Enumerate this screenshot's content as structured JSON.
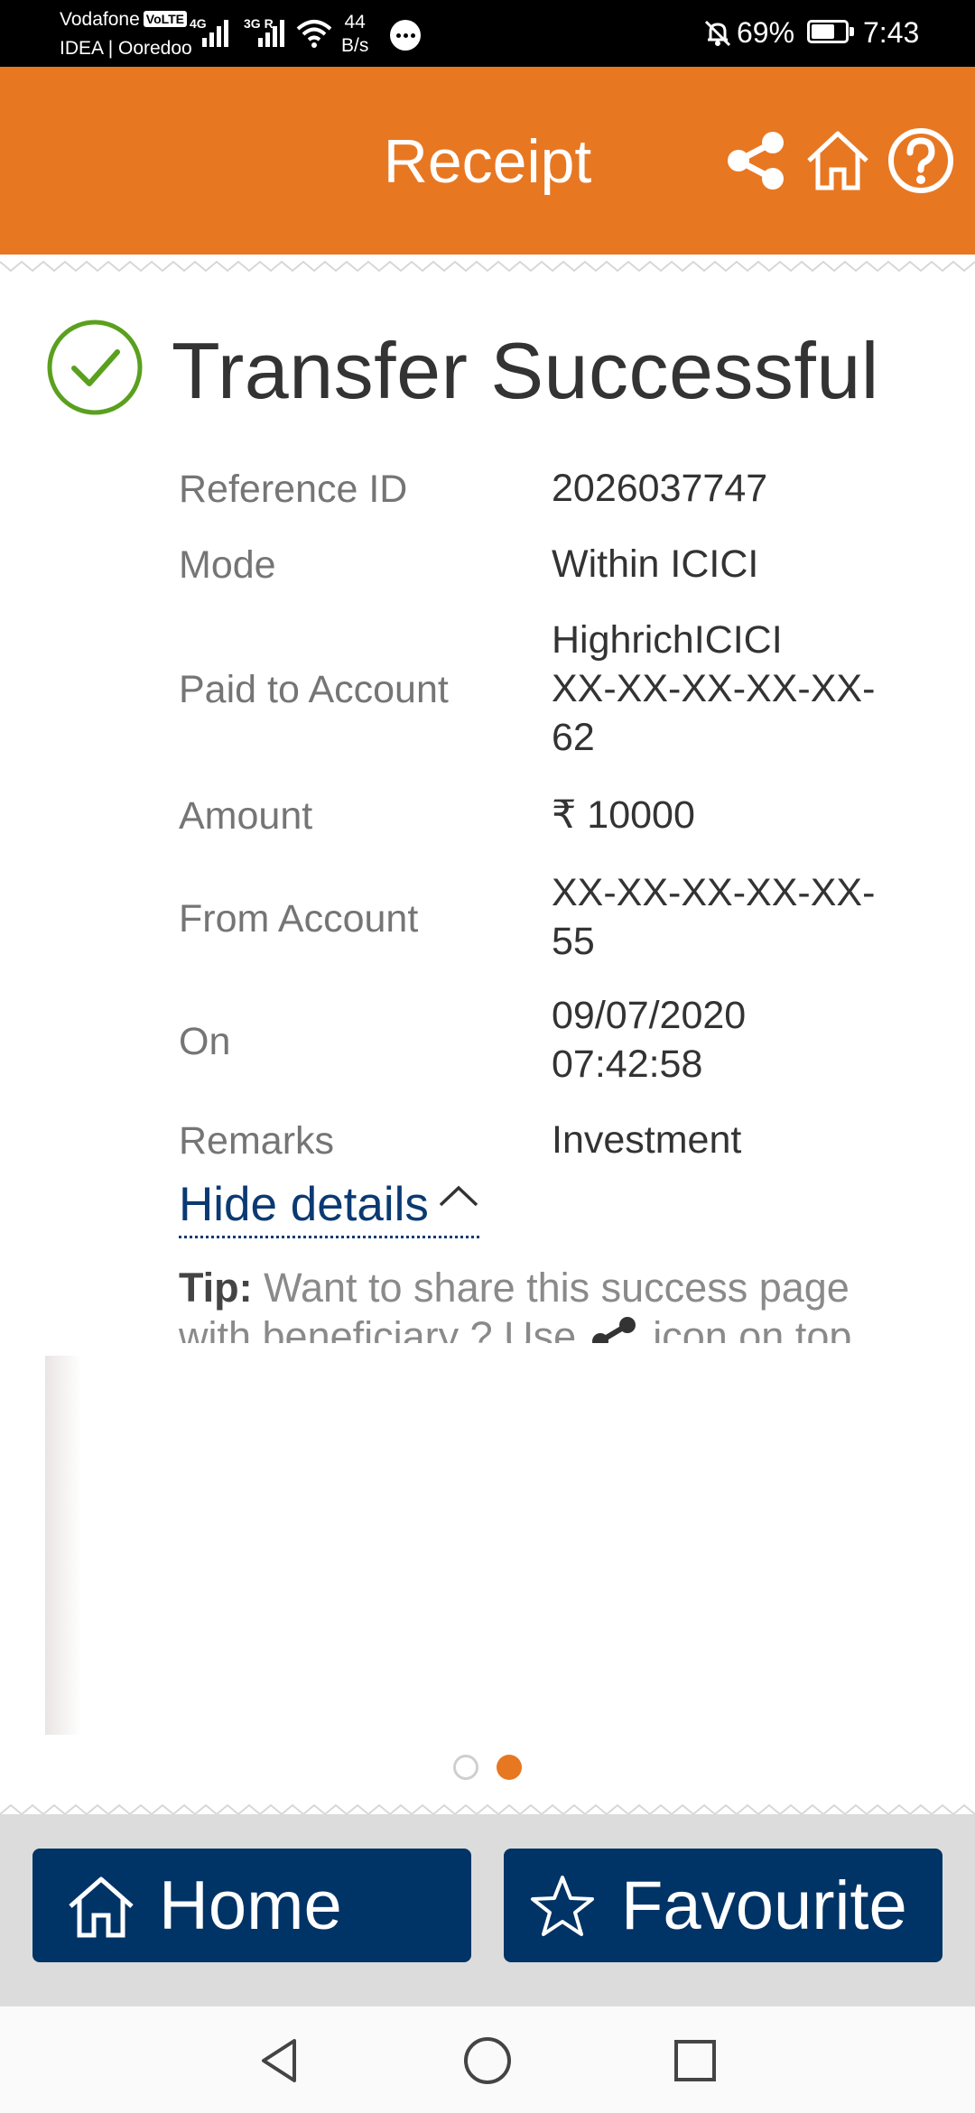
{
  "status_bar": {
    "carrier_1": "Vodafone",
    "volte": "VoLTE",
    "carrier_2": "IDEA | Ooredoo",
    "net_1": "4G",
    "net_2": "3G R",
    "speed_value": "44",
    "speed_unit": "B/s",
    "battery": "69%",
    "battery_level": 0.69,
    "time": "7:43"
  },
  "header": {
    "title": "Receipt",
    "icons": [
      "share-icon",
      "home-icon",
      "help-icon"
    ],
    "color": "#e87722"
  },
  "receipt": {
    "status_icon": "check-circle-icon",
    "title": "Transfer Successful",
    "rows": [
      {
        "label": "Reference ID",
        "value_lines": [
          "2026037747"
        ]
      },
      {
        "label": "Mode",
        "value_lines": [
          "Within ICICI"
        ]
      },
      {
        "label": "Paid to Account",
        "value_lines": [
          "HighrichICICI",
          "XX-XX-XX-XX-XX-",
          "62"
        ]
      },
      {
        "label": "Amount",
        "value_lines": [
          "₹ 10000"
        ]
      },
      {
        "label": "From Account",
        "value_lines": [
          "XX-XX-XX-XX-XX-",
          "55"
        ]
      },
      {
        "label": "On",
        "value_lines": [
          "09/07/2020",
          "07:42:58"
        ]
      },
      {
        "label": "Remarks",
        "value_lines": [
          "Investment"
        ]
      }
    ],
    "toggle_label": "Hide details",
    "tip_label": "Tip:",
    "tip_text_1": " Want to share this success page",
    "tip_text_2a": "with beneficiary ? Use ",
    "tip_text_2b": " icon on top"
  },
  "carousel": {
    "pages": 2,
    "active_index": 1
  },
  "actions": {
    "home_label": "Home",
    "favourite_label": "Favourite",
    "button_color": "#003366"
  },
  "nav_bar": {
    "icons": [
      "back-icon",
      "home-circle-icon",
      "recents-icon"
    ]
  }
}
